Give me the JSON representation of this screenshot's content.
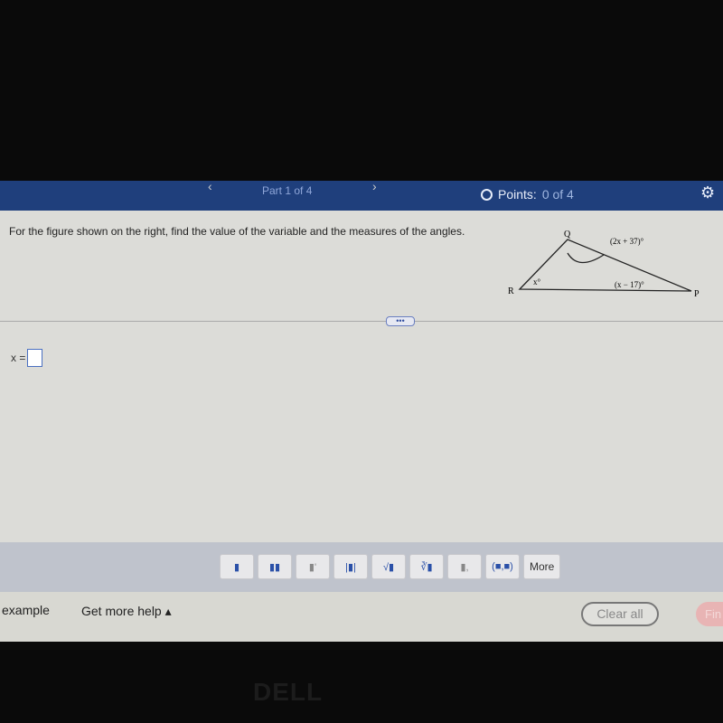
{
  "header": {
    "part": "Part 1 of 4",
    "points_label": "Points:",
    "points_value": "0 of 4",
    "prev_icon": "chevron-left-icon",
    "next_icon": "chevron-right-icon",
    "settings_icon": "gear-icon"
  },
  "question": {
    "text": "For the figure shown on the right, find the value of the variable and the measures of the angles.",
    "figure": {
      "vertices": [
        "Q",
        "R",
        "P"
      ],
      "angle_q": "(2x + 37)°",
      "angle_r": "x°",
      "angle_p": "(x − 17)°"
    }
  },
  "expand_label": "•••",
  "answer": {
    "label": "x =",
    "value": ""
  },
  "toolbar": {
    "tools": [
      "fraction",
      "mixed number",
      "exponent",
      "absolute value",
      "square root",
      "nth root",
      "subscript",
      "(■,■)"
    ],
    "more": "More"
  },
  "footer": {
    "example": "example",
    "help": "Get more help ▴",
    "clear_all": "Clear all",
    "final": "Fin"
  },
  "brand": "DELL"
}
